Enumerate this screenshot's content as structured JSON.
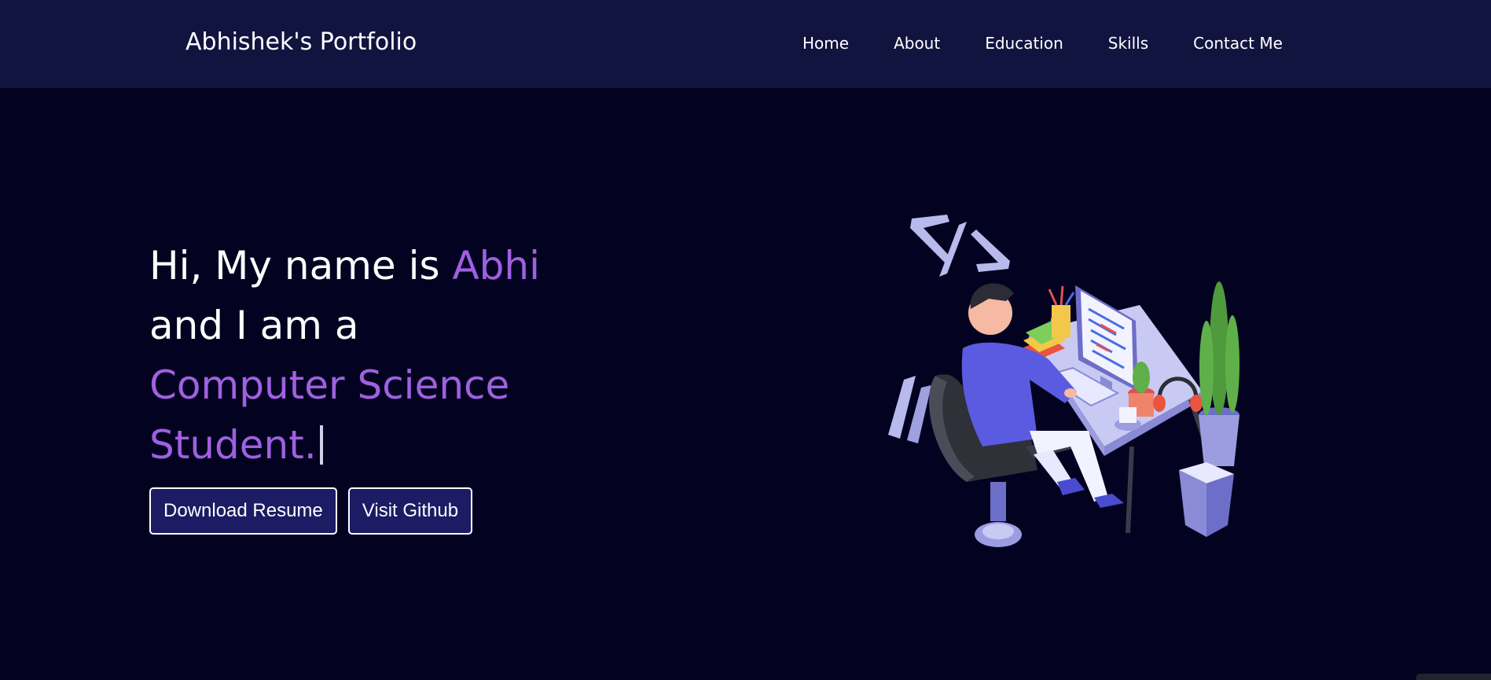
{
  "navbar": {
    "brand": "Abhishek's Portfolio",
    "links": [
      "Home",
      "About",
      "Education",
      "Skills",
      "Contact Me"
    ]
  },
  "hero": {
    "line1_prefix": "Hi, My name is ",
    "line1_name": "Abhi",
    "line2": "and I am a",
    "line3": "Computer Science",
    "line4": "Student.",
    "buttons": {
      "resume": "Download Resume",
      "github": "Visit Github"
    },
    "illustration": "developer-at-desk-illustration"
  },
  "colors": {
    "navbar_bg": "#121440",
    "page_bg": "#030321",
    "accent": "#a060e0",
    "button_bg": "#1b1c63"
  }
}
